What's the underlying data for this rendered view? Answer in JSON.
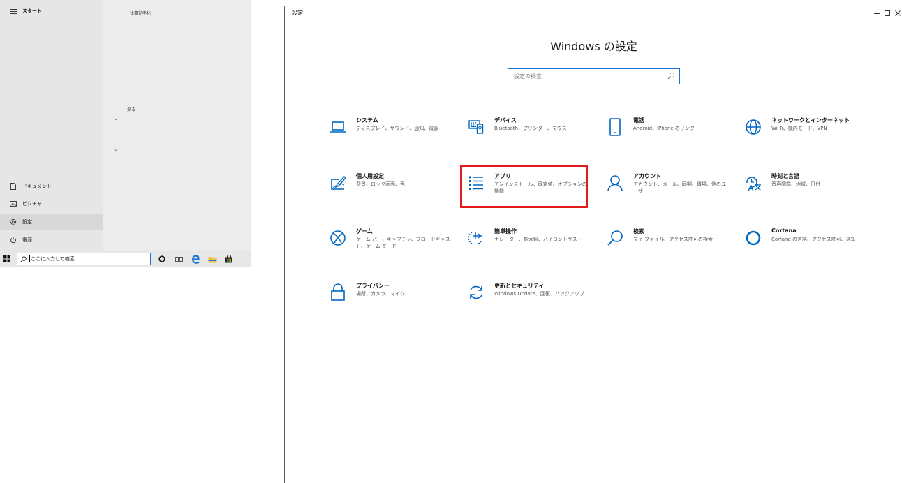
{
  "start_menu": {
    "menu_label": "スタート",
    "tile_group_1": "仕事効率化",
    "tile_group_2": "探る",
    "items": [
      {
        "label": "ドキュメント",
        "icon": "document-icon"
      },
      {
        "label": "ピクチャ",
        "icon": "pictures-icon"
      },
      {
        "label": "設定",
        "icon": "gear-icon"
      },
      {
        "label": "電源",
        "icon": "power-icon"
      }
    ]
  },
  "taskbar": {
    "search_text": "ここに入力して検索"
  },
  "settings": {
    "window_title": "設定",
    "heading": "Windows の設定",
    "search_placeholder": "設定の検索",
    "categories": [
      {
        "name": "システム",
        "desc": "ディスプレイ、サウンド、通知、電源"
      },
      {
        "name": "デバイス",
        "desc": "Bluetooth、プリンター、マウス"
      },
      {
        "name": "電話",
        "desc": "Android、iPhone のリンク"
      },
      {
        "name": "ネットワークとインターネット",
        "desc": "Wi-Fi、機内モード、VPN"
      },
      {
        "name": "個人用設定",
        "desc": "背景、ロック画面、色"
      },
      {
        "name": "アプリ",
        "desc": "アンインストール、既定値、オプションの機能"
      },
      {
        "name": "アカウント",
        "desc": "アカウント、メール、同期、職場、他のユーザー"
      },
      {
        "name": "時刻と言語",
        "desc": "音声認識、地域、日付"
      },
      {
        "name": "ゲーム",
        "desc": "ゲーム バー、キャプチャ、ブロードキャスト、ゲーム モード"
      },
      {
        "name": "簡単操作",
        "desc": "ナレーター、拡大鏡、ハイコントラスト"
      },
      {
        "name": "検索",
        "desc": "マイ ファイル、アクセス許可の検索"
      },
      {
        "name": "Cortana",
        "desc": "Cortana の言語、アクセス許可、通知"
      },
      {
        "name": "プライバシー",
        "desc": "場所、カメラ、マイク"
      },
      {
        "name": "更新とセキュリティ",
        "desc": "Windows Update、回復、バックアップ"
      }
    ]
  },
  "colors": {
    "accent": "#0067c0",
    "highlight": "#e21a1a"
  }
}
